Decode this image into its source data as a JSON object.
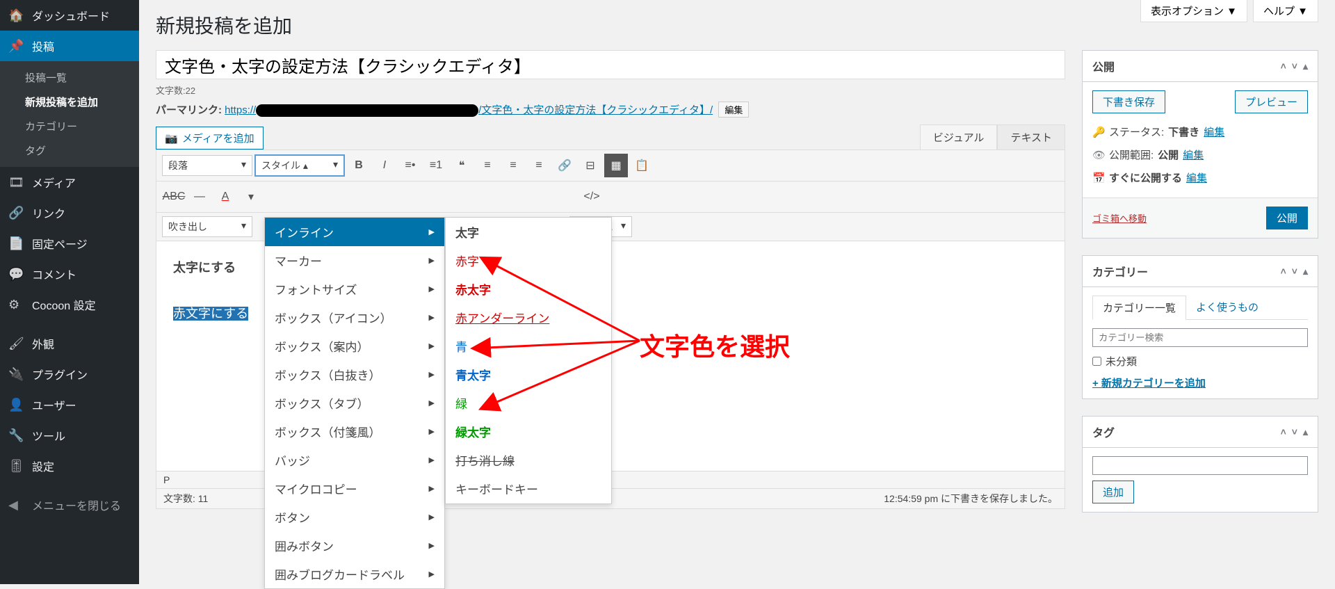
{
  "sidebar": {
    "dashboard": "ダッシュボード",
    "posts": "投稿",
    "sub": {
      "all": "投稿一覧",
      "new": "新規投稿を追加",
      "cat": "カテゴリー",
      "tag": "タグ"
    },
    "media": "メディア",
    "links": "リンク",
    "pages": "固定ページ",
    "comments": "コメント",
    "cocoon": "Cocoon 設定",
    "appearance": "外観",
    "plugins": "プラグイン",
    "users": "ユーザー",
    "tools": "ツール",
    "settings": "設定",
    "collapse": "メニューを閉じる"
  },
  "screen": {
    "options": "表示オプション ▼",
    "help": "ヘルプ ▼"
  },
  "page": {
    "title": "新規投稿を追加",
    "post_title": "文字色・太字の設定方法【クラシックエディタ】",
    "wordcount": "文字数:22",
    "permalink_label": "パーマリンク:",
    "permalink_prefix": "https://",
    "permalink_slug": "/文字色・太字の設定方法【クラシックエディタ】/",
    "permalink_edit": "編集",
    "media_btn": "メディアを追加",
    "tab_visual": "ビジュアル",
    "tab_text": "テキスト"
  },
  "toolbar": {
    "paragraph": "段落",
    "style": "スタイル",
    "speech": "吹き出し",
    "shortcode": "ートコ..."
  },
  "style_menu": {
    "inline": "インライン",
    "marker": "マーカー",
    "fontsize": "フォントサイズ",
    "box_icon": "ボックス（アイコン）",
    "box_guide": "ボックス（案内）",
    "box_white": "ボックス（白抜き）",
    "box_tab": "ボックス（タブ）",
    "box_sticky": "ボックス（付箋風）",
    "badge": "バッジ",
    "microcopy": "マイクロコピー",
    "button": "ボタン",
    "wrap_button": "囲みボタン",
    "wrap_blog": "囲みブログカードラベル"
  },
  "inline_menu": {
    "bold": "太字",
    "red": "赤字",
    "redbold": "赤太字",
    "redunder": "赤アンダーライン",
    "blue": "青",
    "bluebold": "青太字",
    "green": "緑",
    "greenbold": "緑太字",
    "strike": "打ち消し線",
    "kbd": "キーボードキー"
  },
  "content": {
    "line1": "太字にする",
    "line2": "赤文字にする"
  },
  "status": {
    "path": "P",
    "chars": "文字数: 11",
    "saved": "12:54:59 pm に下書きを保存しました。"
  },
  "publish": {
    "title": "公開",
    "save_draft": "下書き保存",
    "preview": "プレビュー",
    "status_label": "ステータス:",
    "status_val": "下書き",
    "visibility_label": "公開範囲:",
    "visibility_val": "公開",
    "schedule": "すぐに公開する",
    "edit": "編集",
    "trash": "ゴミ箱へ移動",
    "publish_btn": "公開"
  },
  "category": {
    "title": "カテゴリー",
    "tab_list": "カテゴリー一覧",
    "tab_freq": "よく使うもの",
    "search_ph": "カテゴリー検索",
    "uncat": "未分類",
    "add": "+ 新規カテゴリーを追加"
  },
  "tags": {
    "title": "タグ",
    "add": "追加"
  },
  "annotation": "文字色を選択"
}
